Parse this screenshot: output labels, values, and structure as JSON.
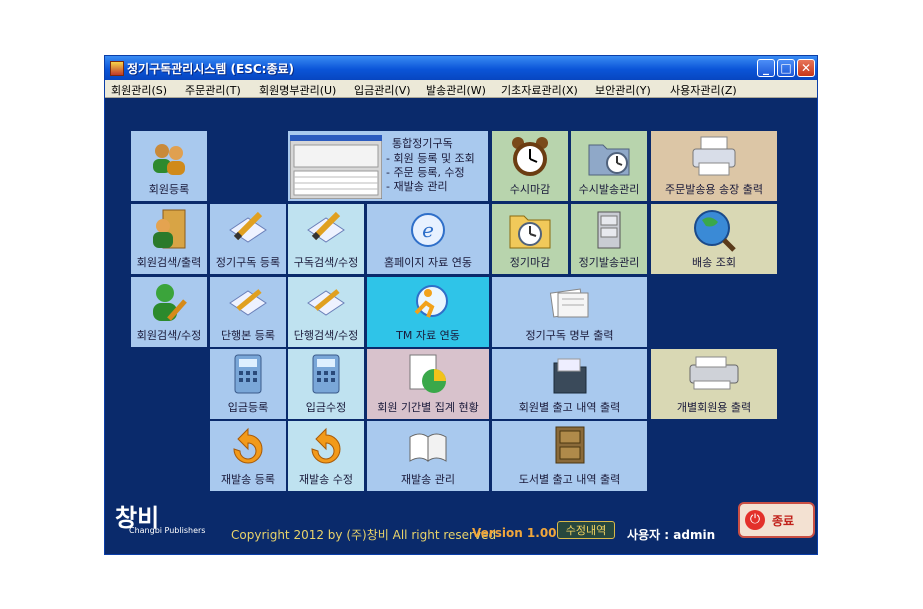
{
  "window": {
    "title": "정기구독관리시스템 (ESC:종료)",
    "controls": {
      "minimize": "_",
      "maximize": "□",
      "close": "✕"
    }
  },
  "menu": [
    "회원관리(S)",
    "주문관리(T)",
    "회원명부관리(U)",
    "입금관리(V)",
    "발송관리(W)",
    "기초자료관리(X)",
    "보안관리(Y)",
    "사용자관리(Z)"
  ],
  "tiles": {
    "member_register": "회원등록",
    "member_search_print": "회원검색/출력",
    "member_search_edit": "회원검색/수정",
    "integrated_info": {
      "title": "통합정기구독",
      "lines": [
        "- 회원 등록 및 조회",
        "- 주문 등록, 수정",
        "- 재발송 관리"
      ]
    },
    "adhoc_deadline": "수시마감",
    "adhoc_ship": "수시발송관리",
    "order_ship_print": "주문발송용 송장 출력",
    "sub_register": "정기구독 등록",
    "sub_search": "구독검색/수정",
    "homepage_link": "홈페이지 자료 연동",
    "regular_deadline": "정기마감",
    "regular_ship": "정기발송관리",
    "delivery_lookup": "배송 조회",
    "single_register": "단행본 등록",
    "single_search": "단행검색/수정",
    "tm_link": "TM 자료 연동",
    "sub_list_print": "정기구독 명부 출력",
    "deposit_register": "입금등록",
    "deposit_edit": "입금수정",
    "member_period_stats": "회원 기간별 집계 현황",
    "member_shipment_print": "회원별 출고 내역 출력",
    "individual_print": "개별회원용 출력",
    "reship_register": "재발송 등록",
    "reship_edit": "재발송 수정",
    "reship_manage": "재발송 관리",
    "book_shipment_print": "도서별 출고 내역 출력"
  },
  "footer": {
    "logo_ko": "창비",
    "logo_en": "Changbi Publishers",
    "copyright": "Copyright 2012 by (주)창비 All right reserved",
    "version": "Version 1.000",
    "revision_button": "수정내역",
    "user_label": "사용자 : admin",
    "exit_button": "종료"
  }
}
